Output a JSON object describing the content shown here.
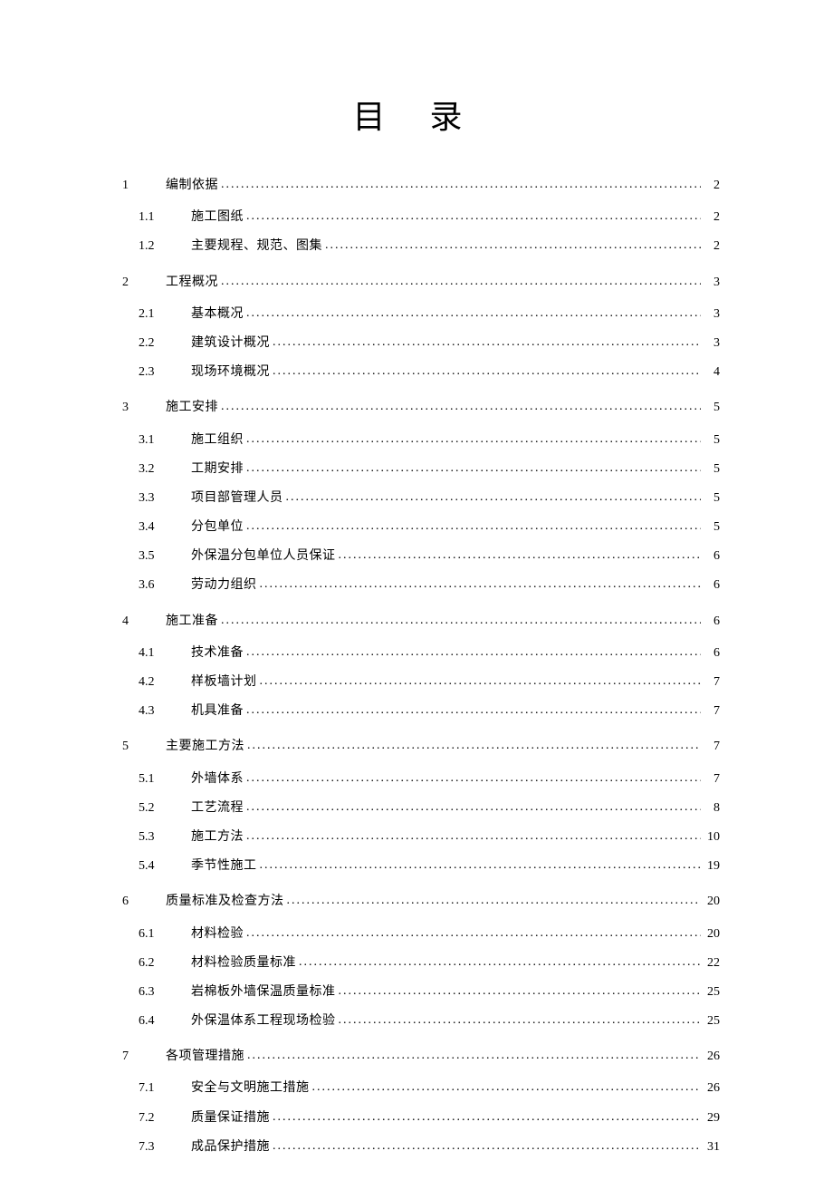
{
  "title": "目  录",
  "entries": [
    {
      "level": 1,
      "num": "1",
      "text": "编制依据",
      "page": "2"
    },
    {
      "level": 2,
      "num": "1.1",
      "text": "施工图纸",
      "page": "2"
    },
    {
      "level": 2,
      "num": "1.2",
      "text": "主要规程、规范、图集",
      "page": "2"
    },
    {
      "level": 1,
      "num": "2",
      "text": "工程概况",
      "page": "3"
    },
    {
      "level": 2,
      "num": "2.1",
      "text": "基本概况",
      "page": "3"
    },
    {
      "level": 2,
      "num": "2.2",
      "text": "建筑设计概况",
      "page": "3"
    },
    {
      "level": 2,
      "num": "2.3",
      "text": "现场环境概况",
      "page": "4"
    },
    {
      "level": 1,
      "num": "3",
      "text": "施工安排",
      "page": "5"
    },
    {
      "level": 2,
      "num": "3.1",
      "text": "施工组织",
      "page": "5"
    },
    {
      "level": 2,
      "num": "3.2",
      "text": "工期安排",
      "page": "5"
    },
    {
      "level": 2,
      "num": "3.3",
      "text": "项目部管理人员",
      "page": "5"
    },
    {
      "level": 2,
      "num": "3.4",
      "text": "分包单位",
      "page": "5"
    },
    {
      "level": 2,
      "num": "3.5",
      "text": "外保温分包单位人员保证",
      "page": "6"
    },
    {
      "level": 2,
      "num": "3.6",
      "text": "劳动力组织",
      "page": "6"
    },
    {
      "level": 1,
      "num": "4",
      "text": "施工准备",
      "page": "6"
    },
    {
      "level": 2,
      "num": "4.1",
      "text": "技术准备",
      "page": "6"
    },
    {
      "level": 2,
      "num": "4.2",
      "text": "样板墙计划",
      "page": "7"
    },
    {
      "level": 2,
      "num": "4.3",
      "text": "机具准备",
      "page": "7"
    },
    {
      "level": 1,
      "num": "5",
      "text": "主要施工方法",
      "page": "7"
    },
    {
      "level": 2,
      "num": "5.1",
      "text": "外墙体系",
      "page": "7"
    },
    {
      "level": 2,
      "num": "5.2",
      "text": "工艺流程",
      "page": "8"
    },
    {
      "level": 2,
      "num": "5.3",
      "text": "施工方法",
      "page": "10"
    },
    {
      "level": 2,
      "num": "5.4",
      "text": "季节性施工",
      "page": "19"
    },
    {
      "level": 1,
      "num": "6",
      "text": "质量标准及检查方法",
      "page": "20"
    },
    {
      "level": 2,
      "num": "6.1",
      "text": "材料检验",
      "page": "20"
    },
    {
      "level": 2,
      "num": "6.2",
      "text": "材料检验质量标准",
      "page": "22"
    },
    {
      "level": 2,
      "num": "6.3",
      "text": "岩棉板外墙保温质量标准",
      "page": "25"
    },
    {
      "level": 2,
      "num": "6.4",
      "text": "外保温体系工程现场检验",
      "page": "25"
    },
    {
      "level": 1,
      "num": "7",
      "text": "各项管理措施",
      "page": "26"
    },
    {
      "level": 2,
      "num": "7.1",
      "text": "安全与文明施工措施",
      "page": "26"
    },
    {
      "level": 2,
      "num": "7.2",
      "text": "质量保证措施",
      "page": "29"
    },
    {
      "level": 2,
      "num": "7.3",
      "text": "成品保护措施",
      "page": "31"
    }
  ]
}
